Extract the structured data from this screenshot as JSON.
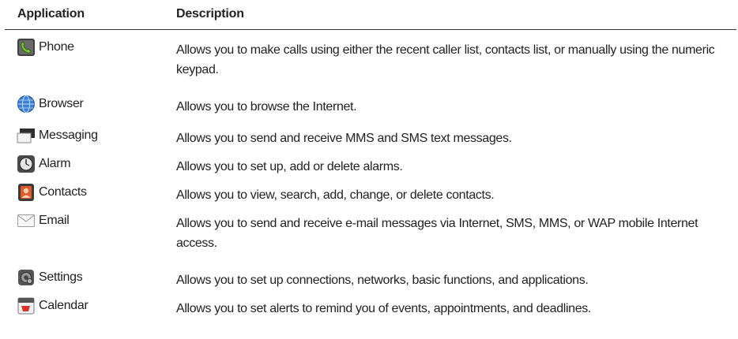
{
  "table": {
    "headers": {
      "application": "Application",
      "description": "Description"
    },
    "rows": [
      {
        "name": "Phone",
        "icon": "phone-app-icon",
        "description": "Allows you to make calls using either the recent caller list, contacts list, or manually using the numeric keypad."
      },
      {
        "name": "Browser",
        "icon": "browser-globe-icon",
        "description": "Allows you to browse the Internet."
      },
      {
        "name": "Messaging",
        "icon": "messaging-app-icon",
        "description": "Allows you to send and receive MMS and SMS text messages."
      },
      {
        "name": "Alarm",
        "icon": "alarm-clock-icon",
        "description": "Allows you to set up, add or delete alarms."
      },
      {
        "name": "Contacts",
        "icon": "contacts-app-icon",
        "description": "Allows you to view, search, add, change, or delete contacts."
      },
      {
        "name": "Email",
        "icon": "email-envelope-icon",
        "description": "Allows you to send and receive e-mail messages via Internet, SMS, MMS, or WAP mobile Internet access."
      },
      {
        "name": "Settings",
        "icon": "settings-gear-icon",
        "description": "Allows you to set up connections, networks, basic functions, and applications."
      },
      {
        "name": "Calendar",
        "icon": "calendar-app-icon",
        "description": "Allows you to set alerts to remind you of events, appointments, and deadlines."
      }
    ]
  }
}
